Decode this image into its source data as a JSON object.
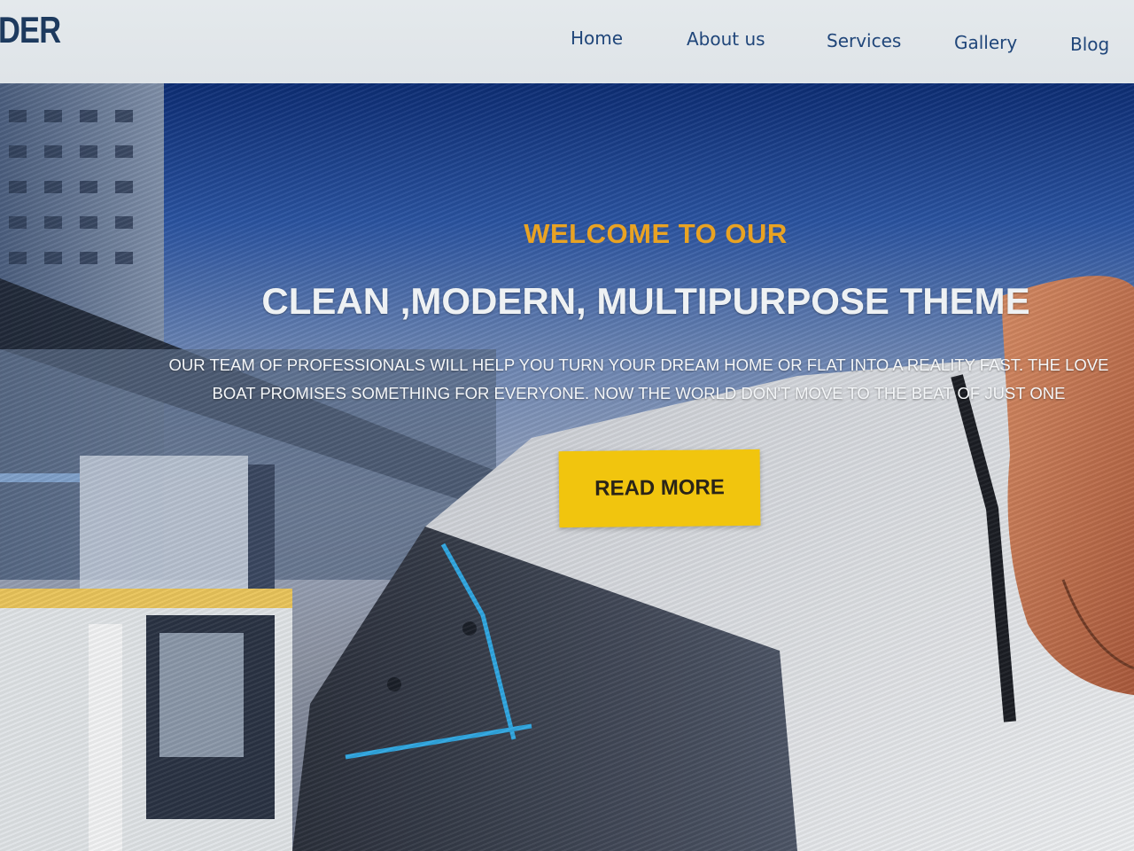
{
  "header": {
    "logo_text": "DER",
    "nav": [
      {
        "label": "Home"
      },
      {
        "label": "About us"
      },
      {
        "label": "Services"
      },
      {
        "label": "Gallery"
      },
      {
        "label": "Blog"
      }
    ]
  },
  "hero": {
    "eyebrow": "WELCOME TO OUR",
    "headline": "CLEAN ,MODERN, MULTIPURPOSE THEME",
    "subtext": "OUR TEAM OF PROFESSIONALS WILL HELP YOU TURN YOUR DREAM HOME OR FLAT INTO A REALITY FAST. THE LOVE BOAT PROMISES SOMETHING FOR EVERYONE. NOW THE WORLD DON'T MOVE TO THE BEAT OF JUST ONE",
    "cta_label": "READ MORE"
  },
  "colors": {
    "accent": "#f1c50e",
    "eyebrow": "#e9a323",
    "nav_text": "#20467a",
    "header_bg": "#e4e9ec"
  }
}
